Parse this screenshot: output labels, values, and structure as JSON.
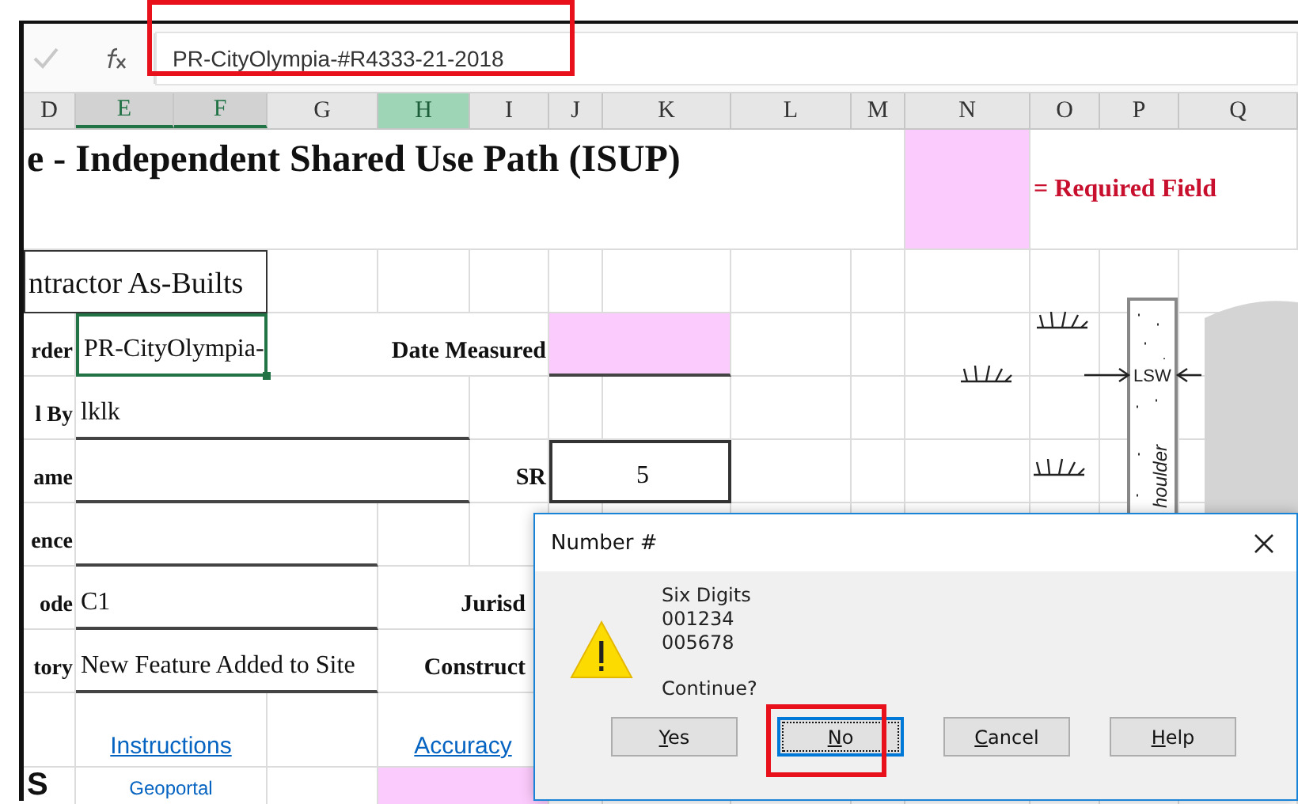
{
  "formula_bar": {
    "value": "PR-CityOlympia-#R4333-21-2018",
    "annotated": true
  },
  "columns": [
    {
      "label": "D",
      "selected": false,
      "highlighted": false
    },
    {
      "label": "E",
      "selected": true,
      "highlighted": false
    },
    {
      "label": "F",
      "selected": true,
      "highlighted": false
    },
    {
      "label": "G",
      "selected": false,
      "highlighted": false
    },
    {
      "label": "H",
      "selected": false,
      "highlighted": true
    },
    {
      "label": "I",
      "selected": false,
      "highlighted": false
    },
    {
      "label": "J",
      "selected": false,
      "highlighted": false
    },
    {
      "label": "K",
      "selected": false,
      "highlighted": false
    },
    {
      "label": "L",
      "selected": false,
      "highlighted": false
    },
    {
      "label": "M",
      "selected": false,
      "highlighted": false
    },
    {
      "label": "N",
      "selected": false,
      "highlighted": false
    },
    {
      "label": "O",
      "selected": false,
      "highlighted": false
    },
    {
      "label": "P",
      "selected": false,
      "highlighted": false
    },
    {
      "label": "Q",
      "selected": false,
      "highlighted": false
    }
  ],
  "sheet": {
    "title": "e - Independent Shared Use Path (ISUP)",
    "legend": "= Required Field",
    "section": "ntractor As-Builts",
    "labels": [
      "rder",
      "l By",
      "ame",
      "ence",
      "ode",
      "tory"
    ],
    "order_value": "PR-CityOlympia-",
    "date_label": "Date Measured",
    "by_value": "lklk",
    "sr_label": "SR",
    "sr_value": "5",
    "code_value": "C1",
    "jurisdiction_label": "Jurisd",
    "history_value": "New Feature Added to Site",
    "construction_label": "Construct",
    "links": [
      "Instructions",
      "Accuracy"
    ],
    "big_label": "S",
    "geoportal_link": "Geoportal"
  },
  "diagram": {
    "lane_label": "LSW",
    "shoulder_label": "houlder"
  },
  "dialog": {
    "title": "Number #",
    "lines": [
      "Six Digits",
      "001234",
      "005678"
    ],
    "question": "Continue?",
    "buttons": [
      {
        "label": "Yes",
        "selected": false,
        "annotated": false
      },
      {
        "label": "No",
        "selected": true,
        "annotated": true
      },
      {
        "label": "Cancel",
        "selected": false,
        "annotated": false
      },
      {
        "label": "Help",
        "selected": false,
        "annotated": false
      }
    ]
  }
}
